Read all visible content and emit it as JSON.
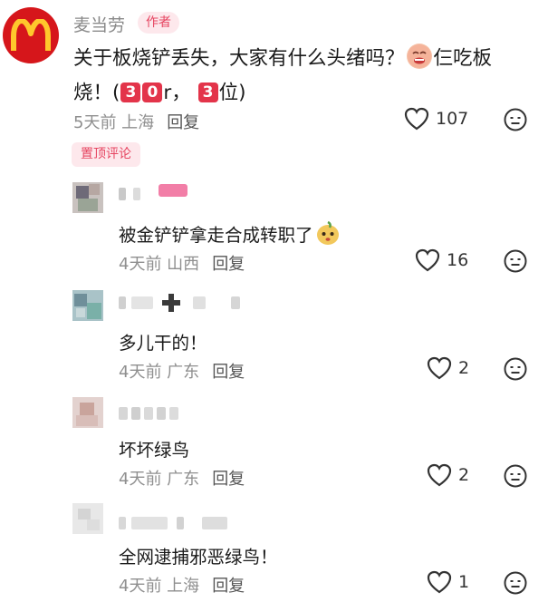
{
  "author_comment": {
    "username": "麦当劳",
    "tag": "作者",
    "text_part1": "关于板烧铲丢失，大家有什么头绪吗？",
    "text_part2": "仨吃板",
    "text_part3": "烧！(",
    "box1": "3",
    "box2": "0",
    "text_part4": "r，",
    "box3": "3",
    "text_part5": "位)",
    "emoji": "crying-face-emoji",
    "meta": "5天前 上海",
    "reply_label": "回复",
    "likes": "107",
    "logo_icon": "mcdonalds-golden-arches-logo"
  },
  "pinned_label": "置顶评论",
  "replies": [
    {
      "text": "被金铲铲拿走合成转职了",
      "emoji": "pear-face-emoji",
      "meta": "4天前 山西",
      "reply_label": "回复",
      "likes": "16"
    },
    {
      "text": "多儿干的！",
      "meta": "4天前 广东",
      "reply_label": "回复",
      "likes": "2"
    },
    {
      "text": "坏坏绿鸟",
      "meta": "4天前 广东",
      "reply_label": "回复",
      "likes": "2"
    },
    {
      "text": "全网逮捕邪恶绿鸟！",
      "meta": "4天前 上海",
      "reply_label": "回复",
      "likes": "1"
    }
  ],
  "colors": {
    "brand_red": "#d6161b",
    "tag_pink": "#e64561",
    "tag_bg": "#fde8ec",
    "muted": "#8f8f8f"
  }
}
